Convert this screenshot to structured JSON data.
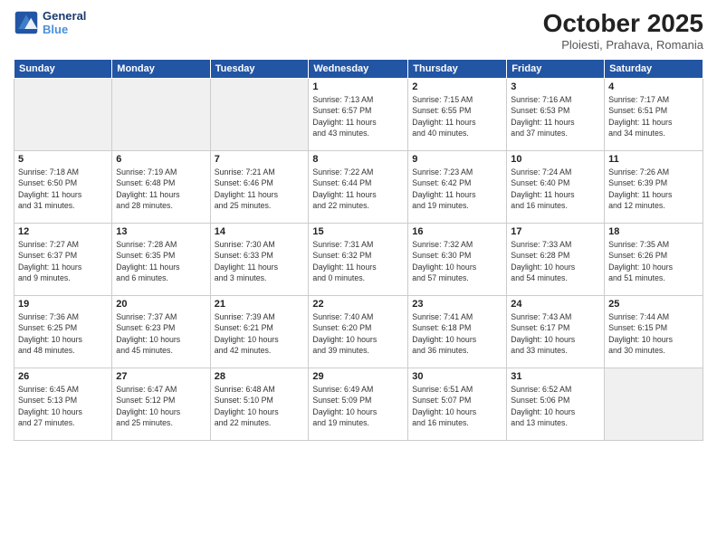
{
  "header": {
    "logo_line1": "General",
    "logo_line2": "Blue",
    "month": "October 2025",
    "location": "Ploiesti, Prahava, Romania"
  },
  "weekdays": [
    "Sunday",
    "Monday",
    "Tuesday",
    "Wednesday",
    "Thursday",
    "Friday",
    "Saturday"
  ],
  "weeks": [
    [
      {
        "day": "",
        "info": ""
      },
      {
        "day": "",
        "info": ""
      },
      {
        "day": "",
        "info": ""
      },
      {
        "day": "1",
        "info": "Sunrise: 7:13 AM\nSunset: 6:57 PM\nDaylight: 11 hours\nand 43 minutes."
      },
      {
        "day": "2",
        "info": "Sunrise: 7:15 AM\nSunset: 6:55 PM\nDaylight: 11 hours\nand 40 minutes."
      },
      {
        "day": "3",
        "info": "Sunrise: 7:16 AM\nSunset: 6:53 PM\nDaylight: 11 hours\nand 37 minutes."
      },
      {
        "day": "4",
        "info": "Sunrise: 7:17 AM\nSunset: 6:51 PM\nDaylight: 11 hours\nand 34 minutes."
      }
    ],
    [
      {
        "day": "5",
        "info": "Sunrise: 7:18 AM\nSunset: 6:50 PM\nDaylight: 11 hours\nand 31 minutes."
      },
      {
        "day": "6",
        "info": "Sunrise: 7:19 AM\nSunset: 6:48 PM\nDaylight: 11 hours\nand 28 minutes."
      },
      {
        "day": "7",
        "info": "Sunrise: 7:21 AM\nSunset: 6:46 PM\nDaylight: 11 hours\nand 25 minutes."
      },
      {
        "day": "8",
        "info": "Sunrise: 7:22 AM\nSunset: 6:44 PM\nDaylight: 11 hours\nand 22 minutes."
      },
      {
        "day": "9",
        "info": "Sunrise: 7:23 AM\nSunset: 6:42 PM\nDaylight: 11 hours\nand 19 minutes."
      },
      {
        "day": "10",
        "info": "Sunrise: 7:24 AM\nSunset: 6:40 PM\nDaylight: 11 hours\nand 16 minutes."
      },
      {
        "day": "11",
        "info": "Sunrise: 7:26 AM\nSunset: 6:39 PM\nDaylight: 11 hours\nand 12 minutes."
      }
    ],
    [
      {
        "day": "12",
        "info": "Sunrise: 7:27 AM\nSunset: 6:37 PM\nDaylight: 11 hours\nand 9 minutes."
      },
      {
        "day": "13",
        "info": "Sunrise: 7:28 AM\nSunset: 6:35 PM\nDaylight: 11 hours\nand 6 minutes."
      },
      {
        "day": "14",
        "info": "Sunrise: 7:30 AM\nSunset: 6:33 PM\nDaylight: 11 hours\nand 3 minutes."
      },
      {
        "day": "15",
        "info": "Sunrise: 7:31 AM\nSunset: 6:32 PM\nDaylight: 11 hours\nand 0 minutes."
      },
      {
        "day": "16",
        "info": "Sunrise: 7:32 AM\nSunset: 6:30 PM\nDaylight: 10 hours\nand 57 minutes."
      },
      {
        "day": "17",
        "info": "Sunrise: 7:33 AM\nSunset: 6:28 PM\nDaylight: 10 hours\nand 54 minutes."
      },
      {
        "day": "18",
        "info": "Sunrise: 7:35 AM\nSunset: 6:26 PM\nDaylight: 10 hours\nand 51 minutes."
      }
    ],
    [
      {
        "day": "19",
        "info": "Sunrise: 7:36 AM\nSunset: 6:25 PM\nDaylight: 10 hours\nand 48 minutes."
      },
      {
        "day": "20",
        "info": "Sunrise: 7:37 AM\nSunset: 6:23 PM\nDaylight: 10 hours\nand 45 minutes."
      },
      {
        "day": "21",
        "info": "Sunrise: 7:39 AM\nSunset: 6:21 PM\nDaylight: 10 hours\nand 42 minutes."
      },
      {
        "day": "22",
        "info": "Sunrise: 7:40 AM\nSunset: 6:20 PM\nDaylight: 10 hours\nand 39 minutes."
      },
      {
        "day": "23",
        "info": "Sunrise: 7:41 AM\nSunset: 6:18 PM\nDaylight: 10 hours\nand 36 minutes."
      },
      {
        "day": "24",
        "info": "Sunrise: 7:43 AM\nSunset: 6:17 PM\nDaylight: 10 hours\nand 33 minutes."
      },
      {
        "day": "25",
        "info": "Sunrise: 7:44 AM\nSunset: 6:15 PM\nDaylight: 10 hours\nand 30 minutes."
      }
    ],
    [
      {
        "day": "26",
        "info": "Sunrise: 6:45 AM\nSunset: 5:13 PM\nDaylight: 10 hours\nand 27 minutes."
      },
      {
        "day": "27",
        "info": "Sunrise: 6:47 AM\nSunset: 5:12 PM\nDaylight: 10 hours\nand 25 minutes."
      },
      {
        "day": "28",
        "info": "Sunrise: 6:48 AM\nSunset: 5:10 PM\nDaylight: 10 hours\nand 22 minutes."
      },
      {
        "day": "29",
        "info": "Sunrise: 6:49 AM\nSunset: 5:09 PM\nDaylight: 10 hours\nand 19 minutes."
      },
      {
        "day": "30",
        "info": "Sunrise: 6:51 AM\nSunset: 5:07 PM\nDaylight: 10 hours\nand 16 minutes."
      },
      {
        "day": "31",
        "info": "Sunrise: 6:52 AM\nSunset: 5:06 PM\nDaylight: 10 hours\nand 13 minutes."
      },
      {
        "day": "",
        "info": ""
      }
    ]
  ]
}
